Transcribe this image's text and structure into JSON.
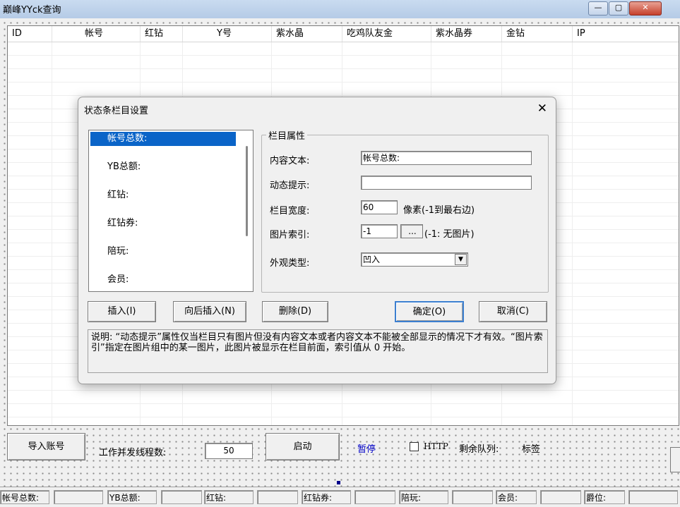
{
  "window": {
    "title": "巅峰YYck查询",
    "buttons": {
      "minimize": "—",
      "maximize": "▢",
      "close": "✕"
    }
  },
  "listview": {
    "columns": [
      "ID",
      "帐号",
      "红钻",
      "Y号",
      "紫水晶",
      "吃鸡队友金",
      "紫水晶券",
      "金钻",
      "IP"
    ]
  },
  "controls": {
    "import_button": "导入账号",
    "threads_label": "工作并发线程数:",
    "threads_value": "50",
    "start_button": "启动",
    "pause_label": "暂停",
    "http_label": "HTTP",
    "queue_label": "剩余队列:",
    "tag_label": "标签"
  },
  "statusbar": [
    "帐号总数:",
    "YB总额:",
    "红钻:",
    "红钻券:",
    "陪玩:",
    "会员:",
    "爵位:"
  ],
  "dialog": {
    "title": "状态条栏目设置",
    "close": "✕",
    "items": [
      "帐号总数:",
      "YB总额:",
      "红钻:",
      "红钻券:",
      "陪玩:",
      "会员:"
    ],
    "group_title": "栏目属性",
    "content_label": "内容文本:",
    "content_value": "帐号总数:",
    "tooltip_label": "动态提示:",
    "tooltip_value": "",
    "width_label": "栏目宽度:",
    "width_value": "60",
    "width_unit": "像素(-1到最右边)",
    "image_label": "图片索引:",
    "image_value": "-1",
    "image_browse": "...",
    "image_note": "(-1: 无图片)",
    "style_label": "外观类型:",
    "style_value": "凹入",
    "buttons": {
      "insert": "插入(I)",
      "insert_after": "向后插入(N)",
      "delete": "删除(D)",
      "ok": "确定(O)",
      "cancel": "取消(C)"
    },
    "note": "说明: “动态提示”属性仅当栏目只有图片但没有内容文本或者内容文本不能被全部显示的情况下才有效。“图片索引”指定在图片组中的某一图片，此图片被显示在栏目前面，索引值从 0 开始。"
  }
}
